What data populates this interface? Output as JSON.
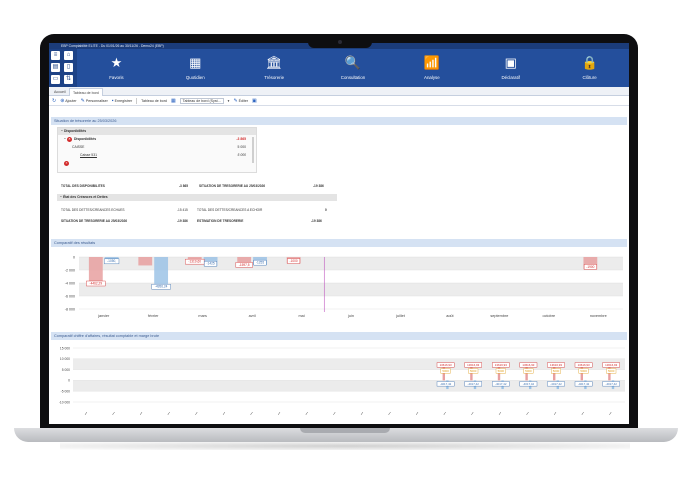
{
  "window": {
    "title": "EBP Comptabilité ELITE - Du 01/01/26 au 30/11/26 - Demo24 (EBP)"
  },
  "nav": [
    {
      "label": "Favoris",
      "icon": "star-icon",
      "glyph": "★"
    },
    {
      "label": "Quotidien",
      "icon": "calendar-icon",
      "glyph": "▦"
    },
    {
      "label": "Trésorerie",
      "icon": "bank-icon",
      "glyph": "🏛"
    },
    {
      "label": "Consultation",
      "icon": "search-doc-icon",
      "glyph": "🔍"
    },
    {
      "label": "Analyse",
      "icon": "chart-icon",
      "glyph": "📶"
    },
    {
      "label": "Déclaratif",
      "icon": "declaration-icon",
      "glyph": "▣"
    },
    {
      "label": "Clôture",
      "icon": "lock-icon",
      "glyph": "🔒"
    }
  ],
  "tabs": {
    "home": "Accueil",
    "dashboard": "Tableau de bord"
  },
  "toolbar": {
    "add": "Ajouter",
    "customize": "Personnaliser",
    "save": "Enregistrer",
    "dashboard_label": "Tableau de bord",
    "dashboard_select": "Tableau de bord (Syst...",
    "edit": "Éditer"
  },
  "treasury": {
    "title": "Situation de trésorerie au 25/03/2026",
    "disponibilites_header": "Disponibilités",
    "disponibilites_label": "Disponibilités",
    "disponibilites_value": "-3 865",
    "caisse_label": "CAISSE",
    "caisse_value": "5 000",
    "caisse531_label": "Caisse 531",
    "caisse531_value": "5 000",
    "total_dispo_label": "TOTAL DES DISPONIBILITES",
    "total_dispo_value": "-3 865",
    "situation_label": "SITUATION DE TRESORERIE AU 25/03/2026",
    "situation_value": "-19 386",
    "creances_header": "État des Créances et Dettes",
    "dettes_label": "TOTAL DES DETTES/CREANCES ECHUES",
    "dettes_value": "-15 415",
    "dettes_a_echoir_label": "TOTAL DES DETTES/CREANCES A ECHOIR",
    "dettes_a_echoir_value": "0",
    "situation2_label": "SITUATION DE TRESORERIE AU 25/03/2026",
    "situation2_value": "-19 386",
    "estimation_label": "ESTIMATION DE TRESORERIE",
    "estimation_value": "-19 386"
  },
  "results_chart_title": "Comparatif des résultats",
  "revenue_chart_title": "Comparatif chiffre d'affaires, résultat comptable et marge brute",
  "chart_data": [
    {
      "type": "bar",
      "title": "Comparatif des résultats",
      "categories": [
        "janvier",
        "février",
        "mars",
        "avril",
        "mai",
        "juin",
        "juillet",
        "août",
        "septembre",
        "octobre",
        "novembre"
      ],
      "ylim": [
        -8000,
        0
      ],
      "yticks": [
        "0",
        "-2 000",
        "-4 000",
        "-6 000",
        "-8 000"
      ],
      "series": [
        {
          "color": "#e8a0a0",
          "values": [
            -4462,
            -1300,
            -1100,
            -1600,
            -1000,
            0,
            0,
            0,
            0,
            0,
            -1900
          ]
        },
        {
          "color": "#9cc3e6",
          "values": [
            -1050,
            -4956,
            -1425,
            -1255,
            0,
            0,
            0,
            0,
            0,
            0,
            0
          ]
        }
      ],
      "labels": [
        {
          "category": 0,
          "text": "-4462,29",
          "tone": "red"
        },
        {
          "category": 0,
          "text": "-1050,",
          "tone": "blue"
        },
        {
          "category": 1,
          "text": "-4956,24",
          "tone": "blue"
        },
        {
          "category": 2,
          "text": "-1319,60",
          "tone": "red"
        },
        {
          "category": 2,
          "text": "-1425",
          "tone": "blue"
        },
        {
          "category": 3,
          "text": "-1597,5",
          "tone": "red"
        },
        {
          "category": 3,
          "text": "-1255",
          "tone": "blue"
        },
        {
          "category": 4,
          "text": "-1000",
          "tone": "red"
        },
        {
          "category": 10,
          "text": "-1900",
          "tone": "red"
        }
      ],
      "grid": true
    },
    {
      "type": "bar",
      "title": "Comparatif chiffre d'affaires, résultat comptable et marge brute",
      "ylim": [
        -10000,
        15000
      ],
      "yticks": [
        "15 000",
        "10 000",
        "5 000",
        "0",
        "-5 000",
        "-10 000"
      ],
      "count": 20,
      "active_from": 13,
      "red_values": [
        8000,
        8000,
        8000,
        8000,
        8000,
        8000,
        8000
      ],
      "blue_values": [
        -4000,
        -4000,
        -4000,
        -4000,
        -4000,
        -4000,
        -4000
      ],
      "red_label": "13616,93",
      "blue_label": "-4017,42",
      "orange_label": "5000",
      "grid": true
    }
  ]
}
